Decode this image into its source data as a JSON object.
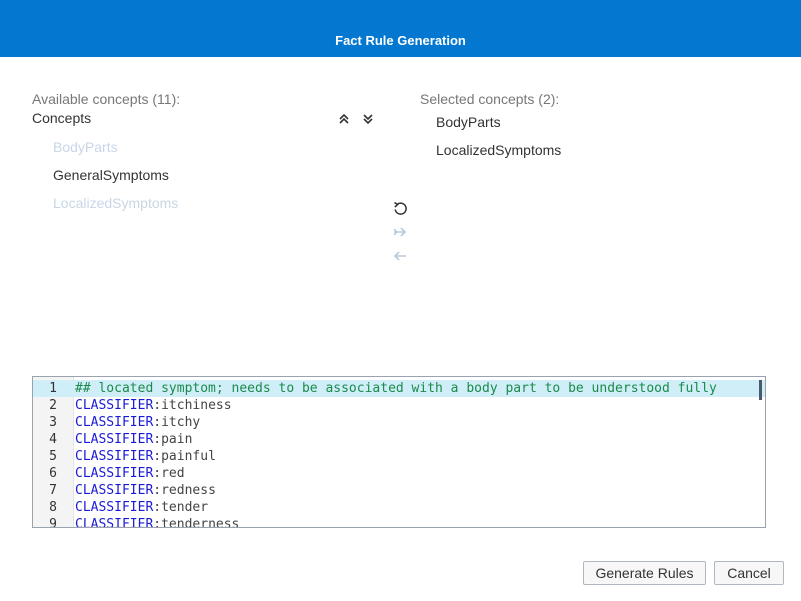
{
  "dialog": {
    "title": "Fact Rule Generation"
  },
  "available": {
    "heading": "Available concepts (11):",
    "group": "Concepts",
    "items": [
      {
        "label": "BodyParts",
        "state": "disabled"
      },
      {
        "label": "GeneralSymptoms",
        "state": "enabled"
      },
      {
        "label": "LocalizedSymptoms",
        "state": "disabled"
      }
    ]
  },
  "selected": {
    "heading": "Selected concepts (2):",
    "items": [
      {
        "label": "BodyParts"
      },
      {
        "label": "LocalizedSymptoms"
      }
    ]
  },
  "icons": {
    "collapse_all": "collapse-all-icon",
    "expand_all": "expand-all-icon",
    "reset": "undo-icon",
    "add": "move-right-icon",
    "remove": "move-left-icon"
  },
  "editor": {
    "lines": [
      {
        "num": "1",
        "keyword": "",
        "text": "## located symptom; needs to be associated with a body part to be understood fully",
        "comment": true
      },
      {
        "num": "2",
        "keyword": "CLASSIFIER",
        "text": ":itchiness"
      },
      {
        "num": "3",
        "keyword": "CLASSIFIER",
        "text": ":itchy"
      },
      {
        "num": "4",
        "keyword": "CLASSIFIER",
        "text": ":pain"
      },
      {
        "num": "5",
        "keyword": "CLASSIFIER",
        "text": ":painful"
      },
      {
        "num": "6",
        "keyword": "CLASSIFIER",
        "text": ":red"
      },
      {
        "num": "7",
        "keyword": "CLASSIFIER",
        "text": ":redness"
      },
      {
        "num": "8",
        "keyword": "CLASSIFIER",
        "text": ":tender"
      },
      {
        "num": "9",
        "keyword": "CLASSIFIER",
        "text": ":tenderness"
      }
    ]
  },
  "buttons": {
    "generate": "Generate Rules",
    "cancel": "Cancel"
  }
}
